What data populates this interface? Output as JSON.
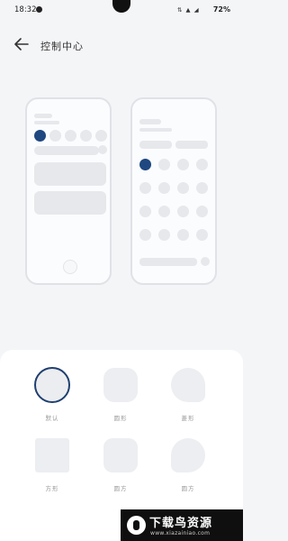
{
  "status_bar": {
    "time": "18:32",
    "icons_text": "⇅ ▲ ◢",
    "battery": "72%"
  },
  "header": {
    "title": "控制中心"
  },
  "shapes": [
    {
      "label": "默认",
      "selected": true
    },
    {
      "label": "圆形"
    },
    {
      "label": "菱形"
    },
    {
      "label": "方形"
    },
    {
      "label": "圆方"
    },
    {
      "label": "圆方"
    }
  ],
  "watermark": {
    "brand": "下载鸟资源",
    "url": "www.xiazainiao.com"
  },
  "colors": {
    "accent": "#1f4780",
    "placeholder": "#e6e8ec",
    "background": "#f4f5f7"
  }
}
